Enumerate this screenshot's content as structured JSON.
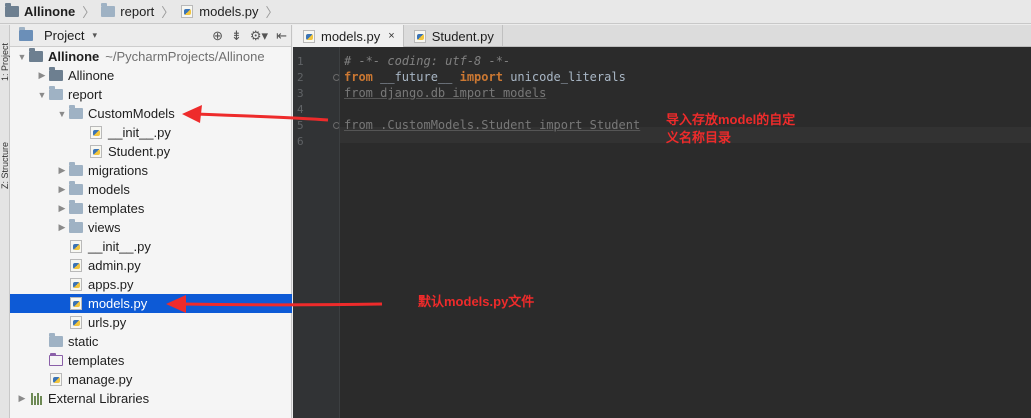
{
  "breadcrumb": [
    {
      "label": "Allinone",
      "bold": true,
      "icon": "folder-icon"
    },
    {
      "label": "report",
      "bold": false,
      "icon": "folder-icon"
    },
    {
      "label": "models.py",
      "bold": false,
      "icon": "python-file-icon"
    }
  ],
  "side_strip": {
    "tab1": "1: Project",
    "tab2": "Z: Structure"
  },
  "project_panel": {
    "title": "Project",
    "dropdown_icon": "chevron-down-icon"
  },
  "tree": [
    {
      "name": "Allinone",
      "hint": "~/PycharmProjects/Allinone",
      "depth": 0,
      "arrow": "down",
      "icon": "folder-dark",
      "bold": true
    },
    {
      "name": "Allinone",
      "depth": 1,
      "arrow": "right",
      "icon": "folder-dark"
    },
    {
      "name": "report",
      "depth": 1,
      "arrow": "down",
      "icon": "folder"
    },
    {
      "name": "CustomModels",
      "depth": 2,
      "arrow": "down",
      "icon": "folder"
    },
    {
      "name": "__init__.py",
      "depth": 3,
      "arrow": "",
      "icon": "py"
    },
    {
      "name": "Student.py",
      "depth": 3,
      "arrow": "",
      "icon": "py"
    },
    {
      "name": "migrations",
      "depth": 2,
      "arrow": "right",
      "icon": "folder"
    },
    {
      "name": "models",
      "depth": 2,
      "arrow": "right",
      "icon": "folder"
    },
    {
      "name": "templates",
      "depth": 2,
      "arrow": "right",
      "icon": "folder"
    },
    {
      "name": "views",
      "depth": 2,
      "arrow": "right",
      "icon": "folder"
    },
    {
      "name": "__init__.py",
      "depth": 2,
      "arrow": "",
      "icon": "py"
    },
    {
      "name": "admin.py",
      "depth": 2,
      "arrow": "",
      "icon": "py"
    },
    {
      "name": "apps.py",
      "depth": 2,
      "arrow": "",
      "icon": "py"
    },
    {
      "name": "models.py",
      "depth": 2,
      "arrow": "",
      "icon": "py",
      "selected": true
    },
    {
      "name": "urls.py",
      "depth": 2,
      "arrow": "",
      "icon": "py"
    },
    {
      "name": "static",
      "depth": 1,
      "arrow": "",
      "icon": "folder"
    },
    {
      "name": "templates",
      "depth": 1,
      "arrow": "",
      "icon": "folder-outline"
    },
    {
      "name": "manage.py",
      "depth": 1,
      "arrow": "",
      "icon": "py"
    },
    {
      "name": "External Libraries",
      "depth": 0,
      "arrow": "right",
      "icon": "library"
    }
  ],
  "tabs": [
    {
      "label": "models.py",
      "active": true,
      "close": "×"
    },
    {
      "label": "Student.py",
      "active": false,
      "close": ""
    }
  ],
  "code_lines": [
    {
      "n": "1",
      "parts": [
        {
          "t": "# -*- coding: utf-8 -*-",
          "c": "cm"
        }
      ]
    },
    {
      "n": "2",
      "parts": [
        {
          "t": "from",
          "c": "kw"
        },
        {
          "t": " __future__ ",
          "c": ""
        },
        {
          "t": "import",
          "c": "kw"
        },
        {
          "t": " unicode_literals",
          "c": ""
        }
      ]
    },
    {
      "n": "3",
      "parts": [
        {
          "t": "from django.db import models",
          "c": "dim"
        }
      ]
    },
    {
      "n": "4",
      "parts": []
    },
    {
      "n": "5",
      "parts": [
        {
          "t": "from .CustomModels.Student import Student",
          "c": "dim"
        }
      ]
    },
    {
      "n": "6",
      "parts": []
    }
  ],
  "annotations": {
    "note1_line1": "导入存放model的自定",
    "note1_line2": "义名称目录",
    "note2": "默认models.py文件",
    "color": "#ee2b2b"
  }
}
